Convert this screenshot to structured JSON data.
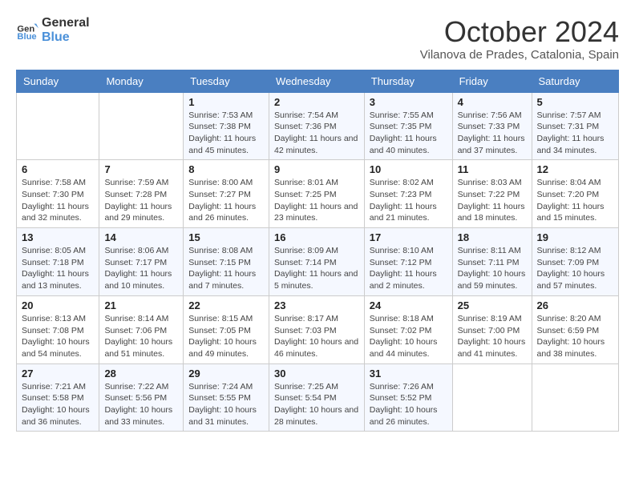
{
  "logo": {
    "line1": "General",
    "line2": "Blue"
  },
  "title": "October 2024",
  "subtitle": "Vilanova de Prades, Catalonia, Spain",
  "days_of_week": [
    "Sunday",
    "Monday",
    "Tuesday",
    "Wednesday",
    "Thursday",
    "Friday",
    "Saturday"
  ],
  "weeks": [
    [
      {
        "day": "",
        "sunrise": "",
        "sunset": "",
        "daylight": ""
      },
      {
        "day": "",
        "sunrise": "",
        "sunset": "",
        "daylight": ""
      },
      {
        "day": "1",
        "sunrise": "Sunrise: 7:53 AM",
        "sunset": "Sunset: 7:38 PM",
        "daylight": "Daylight: 11 hours and 45 minutes."
      },
      {
        "day": "2",
        "sunrise": "Sunrise: 7:54 AM",
        "sunset": "Sunset: 7:36 PM",
        "daylight": "Daylight: 11 hours and 42 minutes."
      },
      {
        "day": "3",
        "sunrise": "Sunrise: 7:55 AM",
        "sunset": "Sunset: 7:35 PM",
        "daylight": "Daylight: 11 hours and 40 minutes."
      },
      {
        "day": "4",
        "sunrise": "Sunrise: 7:56 AM",
        "sunset": "Sunset: 7:33 PM",
        "daylight": "Daylight: 11 hours and 37 minutes."
      },
      {
        "day": "5",
        "sunrise": "Sunrise: 7:57 AM",
        "sunset": "Sunset: 7:31 PM",
        "daylight": "Daylight: 11 hours and 34 minutes."
      }
    ],
    [
      {
        "day": "6",
        "sunrise": "Sunrise: 7:58 AM",
        "sunset": "Sunset: 7:30 PM",
        "daylight": "Daylight: 11 hours and 32 minutes."
      },
      {
        "day": "7",
        "sunrise": "Sunrise: 7:59 AM",
        "sunset": "Sunset: 7:28 PM",
        "daylight": "Daylight: 11 hours and 29 minutes."
      },
      {
        "day": "8",
        "sunrise": "Sunrise: 8:00 AM",
        "sunset": "Sunset: 7:27 PM",
        "daylight": "Daylight: 11 hours and 26 minutes."
      },
      {
        "day": "9",
        "sunrise": "Sunrise: 8:01 AM",
        "sunset": "Sunset: 7:25 PM",
        "daylight": "Daylight: 11 hours and 23 minutes."
      },
      {
        "day": "10",
        "sunrise": "Sunrise: 8:02 AM",
        "sunset": "Sunset: 7:23 PM",
        "daylight": "Daylight: 11 hours and 21 minutes."
      },
      {
        "day": "11",
        "sunrise": "Sunrise: 8:03 AM",
        "sunset": "Sunset: 7:22 PM",
        "daylight": "Daylight: 11 hours and 18 minutes."
      },
      {
        "day": "12",
        "sunrise": "Sunrise: 8:04 AM",
        "sunset": "Sunset: 7:20 PM",
        "daylight": "Daylight: 11 hours and 15 minutes."
      }
    ],
    [
      {
        "day": "13",
        "sunrise": "Sunrise: 8:05 AM",
        "sunset": "Sunset: 7:18 PM",
        "daylight": "Daylight: 11 hours and 13 minutes."
      },
      {
        "day": "14",
        "sunrise": "Sunrise: 8:06 AM",
        "sunset": "Sunset: 7:17 PM",
        "daylight": "Daylight: 11 hours and 10 minutes."
      },
      {
        "day": "15",
        "sunrise": "Sunrise: 8:08 AM",
        "sunset": "Sunset: 7:15 PM",
        "daylight": "Daylight: 11 hours and 7 minutes."
      },
      {
        "day": "16",
        "sunrise": "Sunrise: 8:09 AM",
        "sunset": "Sunset: 7:14 PM",
        "daylight": "Daylight: 11 hours and 5 minutes."
      },
      {
        "day": "17",
        "sunrise": "Sunrise: 8:10 AM",
        "sunset": "Sunset: 7:12 PM",
        "daylight": "Daylight: 11 hours and 2 minutes."
      },
      {
        "day": "18",
        "sunrise": "Sunrise: 8:11 AM",
        "sunset": "Sunset: 7:11 PM",
        "daylight": "Daylight: 10 hours and 59 minutes."
      },
      {
        "day": "19",
        "sunrise": "Sunrise: 8:12 AM",
        "sunset": "Sunset: 7:09 PM",
        "daylight": "Daylight: 10 hours and 57 minutes."
      }
    ],
    [
      {
        "day": "20",
        "sunrise": "Sunrise: 8:13 AM",
        "sunset": "Sunset: 7:08 PM",
        "daylight": "Daylight: 10 hours and 54 minutes."
      },
      {
        "day": "21",
        "sunrise": "Sunrise: 8:14 AM",
        "sunset": "Sunset: 7:06 PM",
        "daylight": "Daylight: 10 hours and 51 minutes."
      },
      {
        "day": "22",
        "sunrise": "Sunrise: 8:15 AM",
        "sunset": "Sunset: 7:05 PM",
        "daylight": "Daylight: 10 hours and 49 minutes."
      },
      {
        "day": "23",
        "sunrise": "Sunrise: 8:17 AM",
        "sunset": "Sunset: 7:03 PM",
        "daylight": "Daylight: 10 hours and 46 minutes."
      },
      {
        "day": "24",
        "sunrise": "Sunrise: 8:18 AM",
        "sunset": "Sunset: 7:02 PM",
        "daylight": "Daylight: 10 hours and 44 minutes."
      },
      {
        "day": "25",
        "sunrise": "Sunrise: 8:19 AM",
        "sunset": "Sunset: 7:00 PM",
        "daylight": "Daylight: 10 hours and 41 minutes."
      },
      {
        "day": "26",
        "sunrise": "Sunrise: 8:20 AM",
        "sunset": "Sunset: 6:59 PM",
        "daylight": "Daylight: 10 hours and 38 minutes."
      }
    ],
    [
      {
        "day": "27",
        "sunrise": "Sunrise: 7:21 AM",
        "sunset": "Sunset: 5:58 PM",
        "daylight": "Daylight: 10 hours and 36 minutes."
      },
      {
        "day": "28",
        "sunrise": "Sunrise: 7:22 AM",
        "sunset": "Sunset: 5:56 PM",
        "daylight": "Daylight: 10 hours and 33 minutes."
      },
      {
        "day": "29",
        "sunrise": "Sunrise: 7:24 AM",
        "sunset": "Sunset: 5:55 PM",
        "daylight": "Daylight: 10 hours and 31 minutes."
      },
      {
        "day": "30",
        "sunrise": "Sunrise: 7:25 AM",
        "sunset": "Sunset: 5:54 PM",
        "daylight": "Daylight: 10 hours and 28 minutes."
      },
      {
        "day": "31",
        "sunrise": "Sunrise: 7:26 AM",
        "sunset": "Sunset: 5:52 PM",
        "daylight": "Daylight: 10 hours and 26 minutes."
      },
      {
        "day": "",
        "sunrise": "",
        "sunset": "",
        "daylight": ""
      },
      {
        "day": "",
        "sunrise": "",
        "sunset": "",
        "daylight": ""
      }
    ]
  ]
}
